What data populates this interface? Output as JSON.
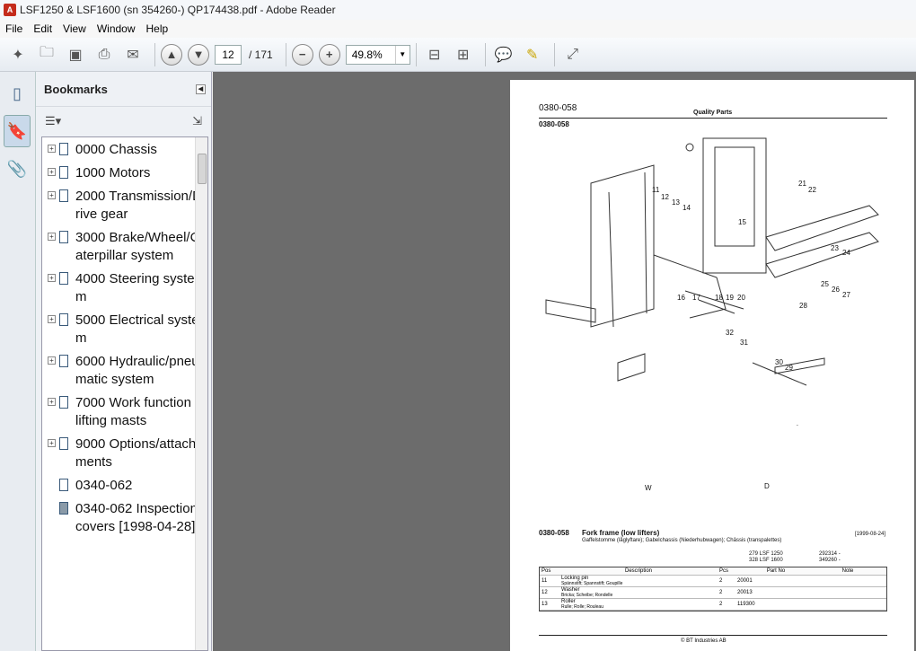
{
  "window": {
    "title": "LSF1250 & LSF1600 (sn 354260-)  QP174438.pdf - Adobe Reader"
  },
  "menu": [
    "File",
    "Edit",
    "View",
    "Window",
    "Help"
  ],
  "toolbar": {
    "page": "12",
    "of": "/  171",
    "zoom": "49.8%"
  },
  "bookmarks": {
    "title": "Bookmarks",
    "items": [
      {
        "label": "0000 Chassis",
        "expand": true
      },
      {
        "label": "1000 Motors",
        "expand": true
      },
      {
        "label": "2000 Transmission/Drive gear",
        "expand": true
      },
      {
        "label": "3000 Brake/Wheel/Caterpillar system",
        "expand": true
      },
      {
        "label": "4000 Steering system",
        "expand": true
      },
      {
        "label": "5000 Electrical system",
        "expand": true
      },
      {
        "label": "6000 Hydraulic/pneumatic system",
        "expand": true
      },
      {
        "label": "7000 Work function - lifting masts",
        "expand": true
      },
      {
        "label": "9000 Options/attachments",
        "expand": true
      },
      {
        "label": "0340-062",
        "expand": false
      },
      {
        "label": "0340-062 Inspection covers [1998-04-28]",
        "expand": false,
        "dark": true
      }
    ]
  },
  "doc": {
    "code": "0380-058",
    "header": "Quality Parts",
    "code2": "0380-058",
    "callouts": [
      "11",
      "12",
      "13",
      "14",
      "15",
      "16",
      "17",
      "18",
      "19",
      "20",
      "21",
      "22",
      "23",
      "24",
      "25",
      "26",
      "27",
      "28",
      "29",
      "30",
      "31",
      "32"
    ],
    "dimW": "W",
    "dimD": "D",
    "fig_title": "0380-058",
    "fig_name": "Fork frame (low lifters)",
    "fig_sub": "Gaffelstomme (låglyftare); Gabelchassis (Niederhubwagen); Châssis (transpalettes)",
    "date": "[1999-08-24]",
    "models": [
      "279   LSF 1250",
      "328   LSF 1600"
    ],
    "serials": [
      "292314 -",
      "349260 -"
    ],
    "columns": [
      "Pos",
      "Description",
      "Pcs",
      "Part No",
      "Note"
    ],
    "rows": [
      {
        "pos": "11",
        "desc": "Locking pin",
        "sub": "Spännstift; Spannstift; Goupille",
        "pcs": "2",
        "part": "20001"
      },
      {
        "pos": "12",
        "desc": "Washer",
        "sub": "Bricka; Scheibe; Rondelle",
        "pcs": "2",
        "part": "20013"
      },
      {
        "pos": "13",
        "desc": "Roller",
        "sub": "Rulle; Rolle; Rouleau",
        "pcs": "2",
        "part": "119300"
      }
    ],
    "footer": "© BT Industries AB"
  }
}
